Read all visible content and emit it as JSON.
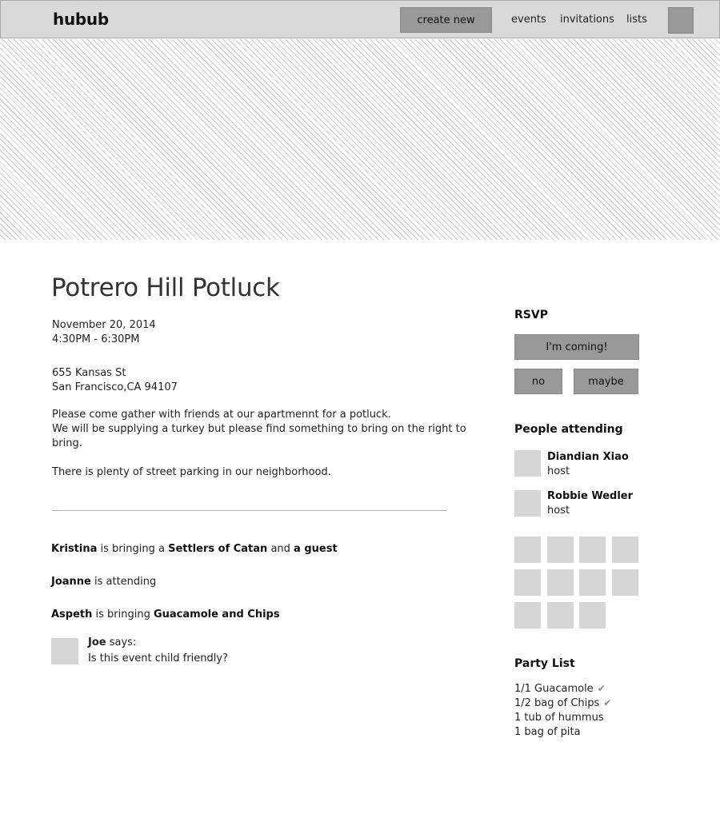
{
  "header": {
    "logo": "hubub",
    "create_label": "create new",
    "nav": [
      "events",
      "invitations",
      "lists"
    ]
  },
  "event": {
    "title": "Potrero Hill Potluck",
    "date": "November 20, 2014",
    "time": "4:30PM - 6:30PM",
    "address_line1": "655 Kansas St",
    "address_line2": "San Francisco,CA 94107",
    "description_line1": "Please come gather with friends at our apartmennt for a potluck.",
    "description_line2": "We will be supplying a turkey but please find something to bring on the right to",
    "description_line3": "bring.",
    "parking": "There is plenty of street parking in our neighborhood."
  },
  "activity": [
    {
      "name": "Kristina",
      "t1": " is bringing a ",
      "item": "Settlers of Catan",
      "t2": " and ",
      "extra": "a guest"
    },
    {
      "name": "Joanne",
      "t1": " is attending"
    },
    {
      "name": "Aspeth",
      "t1": " is bringing ",
      "item": "Guacamole and Chips"
    }
  ],
  "comment": {
    "author": "Joe",
    "says": " says:",
    "text": "Is this event child friendly?"
  },
  "rsvp": {
    "heading": "RSVP",
    "coming_label": "I'm coming!",
    "no_label": "no",
    "maybe_label": "maybe"
  },
  "attending": {
    "heading": "People attending",
    "people": [
      {
        "name": "Diandian Xiao",
        "role": "host"
      },
      {
        "name": "Robbie Wedler",
        "role": "host"
      }
    ]
  },
  "party_list": {
    "heading": "Party List",
    "items": [
      {
        "text": "1/1 Guacamole",
        "checked": true
      },
      {
        "text": "1/2 bag of Chips",
        "checked": true
      },
      {
        "text": "1 tub of hummus",
        "checked": false
      },
      {
        "text": "1 bag of pita",
        "checked": false
      }
    ]
  },
  "icons": {
    "check": "check-icon"
  },
  "colors": {
    "header_bg": "#d9d9d9",
    "button_bg": "#999999",
    "placeholder": "#d6d6d6"
  }
}
